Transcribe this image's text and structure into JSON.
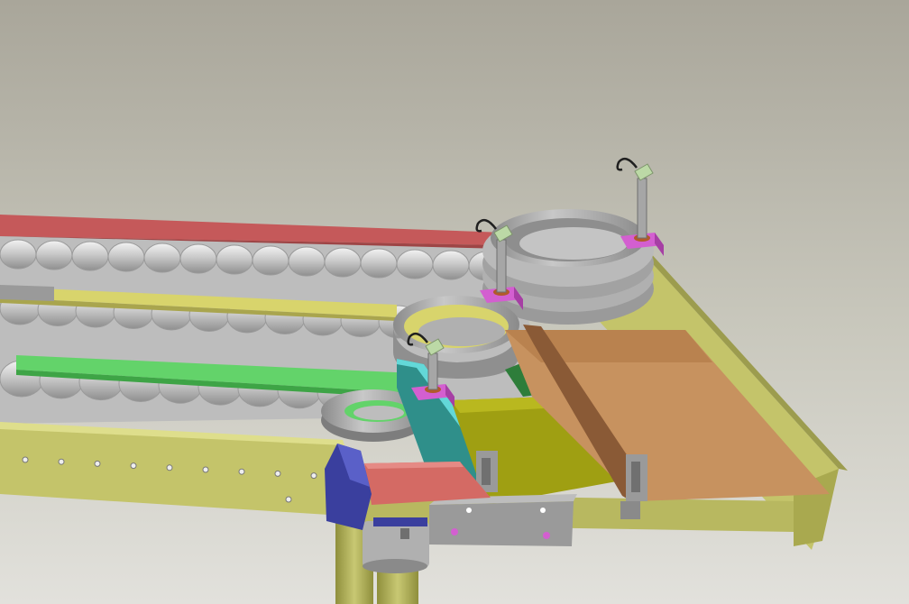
{
  "scene": {
    "kind": "cad-3d-viewport",
    "colors": {
      "background_top": "#a9a69a",
      "background_bottom": "#e2e1dc",
      "frame_olive": "#c4c46a",
      "frame_olive_dark": "#9c9c4e",
      "red_rail": "#c5595a",
      "yellow_guide": "#d8d46c",
      "green_guide": "#63d36a",
      "teal_bracket": "#2f8f8a",
      "cyan_edge": "#63d8d8",
      "olive_plate": "#9f9f12",
      "olive_plate_light": "#b9b81f",
      "orange_plate": "#c7925f",
      "brown_edge": "#8a5a36",
      "dark_green": "#2e7d3a",
      "salmon_plate": "#d46a64",
      "blue_block": "#3a3f9e",
      "magenta_mount": "#d35fd0",
      "gray_metal": "#a6a6a6",
      "gray_dark": "#6f6f6f",
      "copper": "#b15a2a",
      "sensor_tip": "#bcd9a6",
      "cable": "#202020"
    },
    "parts": [
      {
        "name": "roller-conveyor-bed"
      },
      {
        "name": "side-frame-left"
      },
      {
        "name": "side-frame-right"
      },
      {
        "name": "red-top-rail"
      },
      {
        "name": "yellow-guide-rail"
      },
      {
        "name": "green-guide-rail"
      },
      {
        "name": "large-bearing-ring"
      },
      {
        "name": "medium-bearing-ring"
      },
      {
        "name": "small-bearing-ring"
      },
      {
        "name": "proximity-sensor-1"
      },
      {
        "name": "proximity-sensor-2"
      },
      {
        "name": "proximity-sensor-3"
      },
      {
        "name": "orange-pusher-plate"
      },
      {
        "name": "olive-transfer-plate"
      },
      {
        "name": "teal-side-bracket"
      },
      {
        "name": "salmon-plate"
      },
      {
        "name": "blue-end-block"
      },
      {
        "name": "support-leg"
      },
      {
        "name": "actuator-housing"
      }
    ]
  }
}
